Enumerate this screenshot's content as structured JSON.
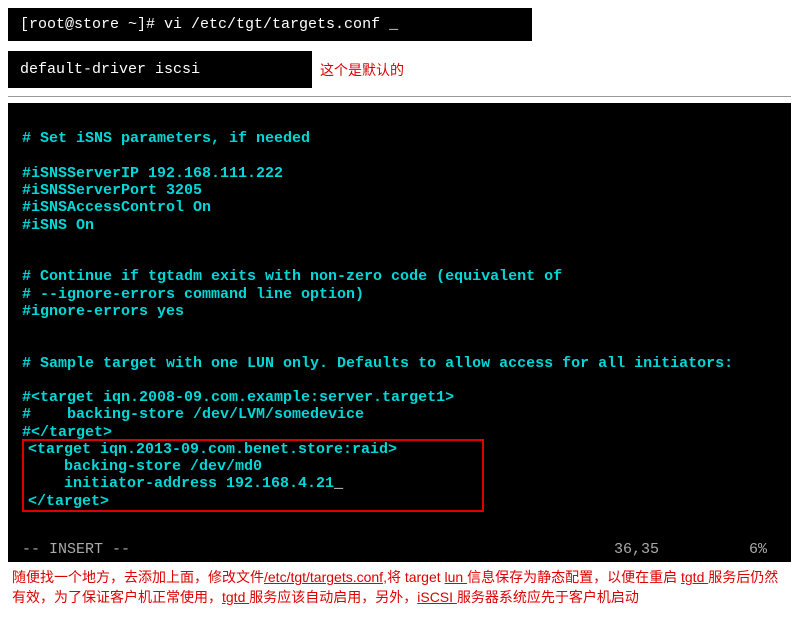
{
  "terminal1": {
    "prompt": "[root@store ~]# ",
    "command": "vi /etc/tgt/targets.conf _"
  },
  "terminal2": {
    "text": "default-driver iscsi"
  },
  "note1": "这个是默认的",
  "editor": {
    "line1": "# Set iSNS parameters, if needed",
    "line2": "#iSNSServerIP 192.168.111.222",
    "line3": "#iSNSServerPort 3205",
    "line4": "#iSNSAccessControl On",
    "line5": "#iSNS On",
    "line6": "# Continue if tgtadm exits with non-zero code (equivalent of",
    "line7": "# --ignore-errors command line option)",
    "line8": "#ignore-errors yes",
    "line9": "# Sample target with one LUN only. Defaults to allow access for all initiators:",
    "line10": "#<target iqn.2008-09.com.example:server.target1>",
    "line11": "#    backing-store /dev/LVM/somedevice",
    "line12": "#</target>",
    "new1": "<target iqn.2013-09.com.benet.store:raid>",
    "new2": "    backing-store /dev/md0",
    "new3": "    initiator-address 192.168.4.21",
    "new4": "</target>",
    "cursor": "_",
    "mode": "-- INSERT --",
    "pos": "36,35",
    "scroll": "6%"
  },
  "para": {
    "t1": "随便找一个地方，去添加上面，修改文件",
    "link1": "/etc/tgt/targets.conf",
    "t2": ",将 target ",
    "u1": "lun ",
    "t3": "信息保存为静态配置，以便在重启 ",
    "link2": "tgtd ",
    "t4": "服务后仍然有效，为了保证客户机正常使用，",
    "link3": "tgtd ",
    "t5": "服务应该自动启用，另外，",
    "link4": "iSCSI ",
    "t6": "服务器系统应先于客户机启动"
  }
}
